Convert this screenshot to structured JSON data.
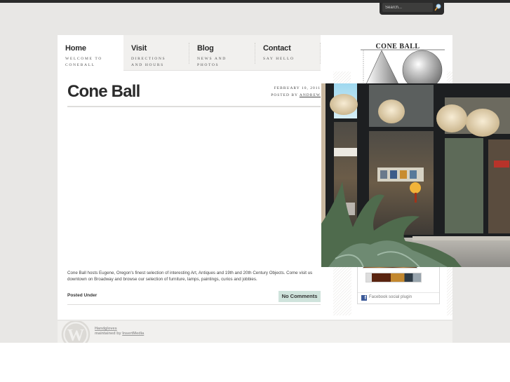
{
  "search": {
    "placeholder": "Search...",
    "icon": "magnifier-icon"
  },
  "nav": {
    "items": [
      {
        "title": "Home",
        "subtitle": "WELCOME TO\nCONEBALL",
        "active": true
      },
      {
        "title": "Visit",
        "subtitle": "DIRECTIONS\nAND HOURS",
        "active": false
      },
      {
        "title": "Blog",
        "subtitle": "NEWS AND\nPHOTOS",
        "active": false
      },
      {
        "title": "Contact",
        "subtitle": "SAY HELLO",
        "active": false
      }
    ]
  },
  "post": {
    "title": "Cone Ball",
    "date": "FEBRUARY 10, 2011",
    "posted_by_label": "POSTED BY",
    "author": "ANDREW",
    "body": "Cone Ball hosts Eugene, Oregon's finest selection of interesting Art, Antiques and 19th and 20th Century Objects. Come visit us downtown on Broadway and browse our selection of furniture, lamps, paintings, curios and jobbies.",
    "posted_under_label": "Posted Under",
    "comments_label": "No Comments"
  },
  "sidebar": {
    "logo_text": "CONE  BALL",
    "facebook_plugin_label": "Facebook social plugin",
    "facebook_icon_glyph": "f"
  },
  "footer": {
    "theme_link": "Handgloves",
    "maintained_by_label": "maintained by",
    "maintainer_link": "InsertMedia"
  },
  "colors": {
    "topbar": "#2b2b2b",
    "page_background": "#e8e7e5",
    "comments_badge": "#cfe3dc",
    "facebook_blue": "#3b5998"
  }
}
